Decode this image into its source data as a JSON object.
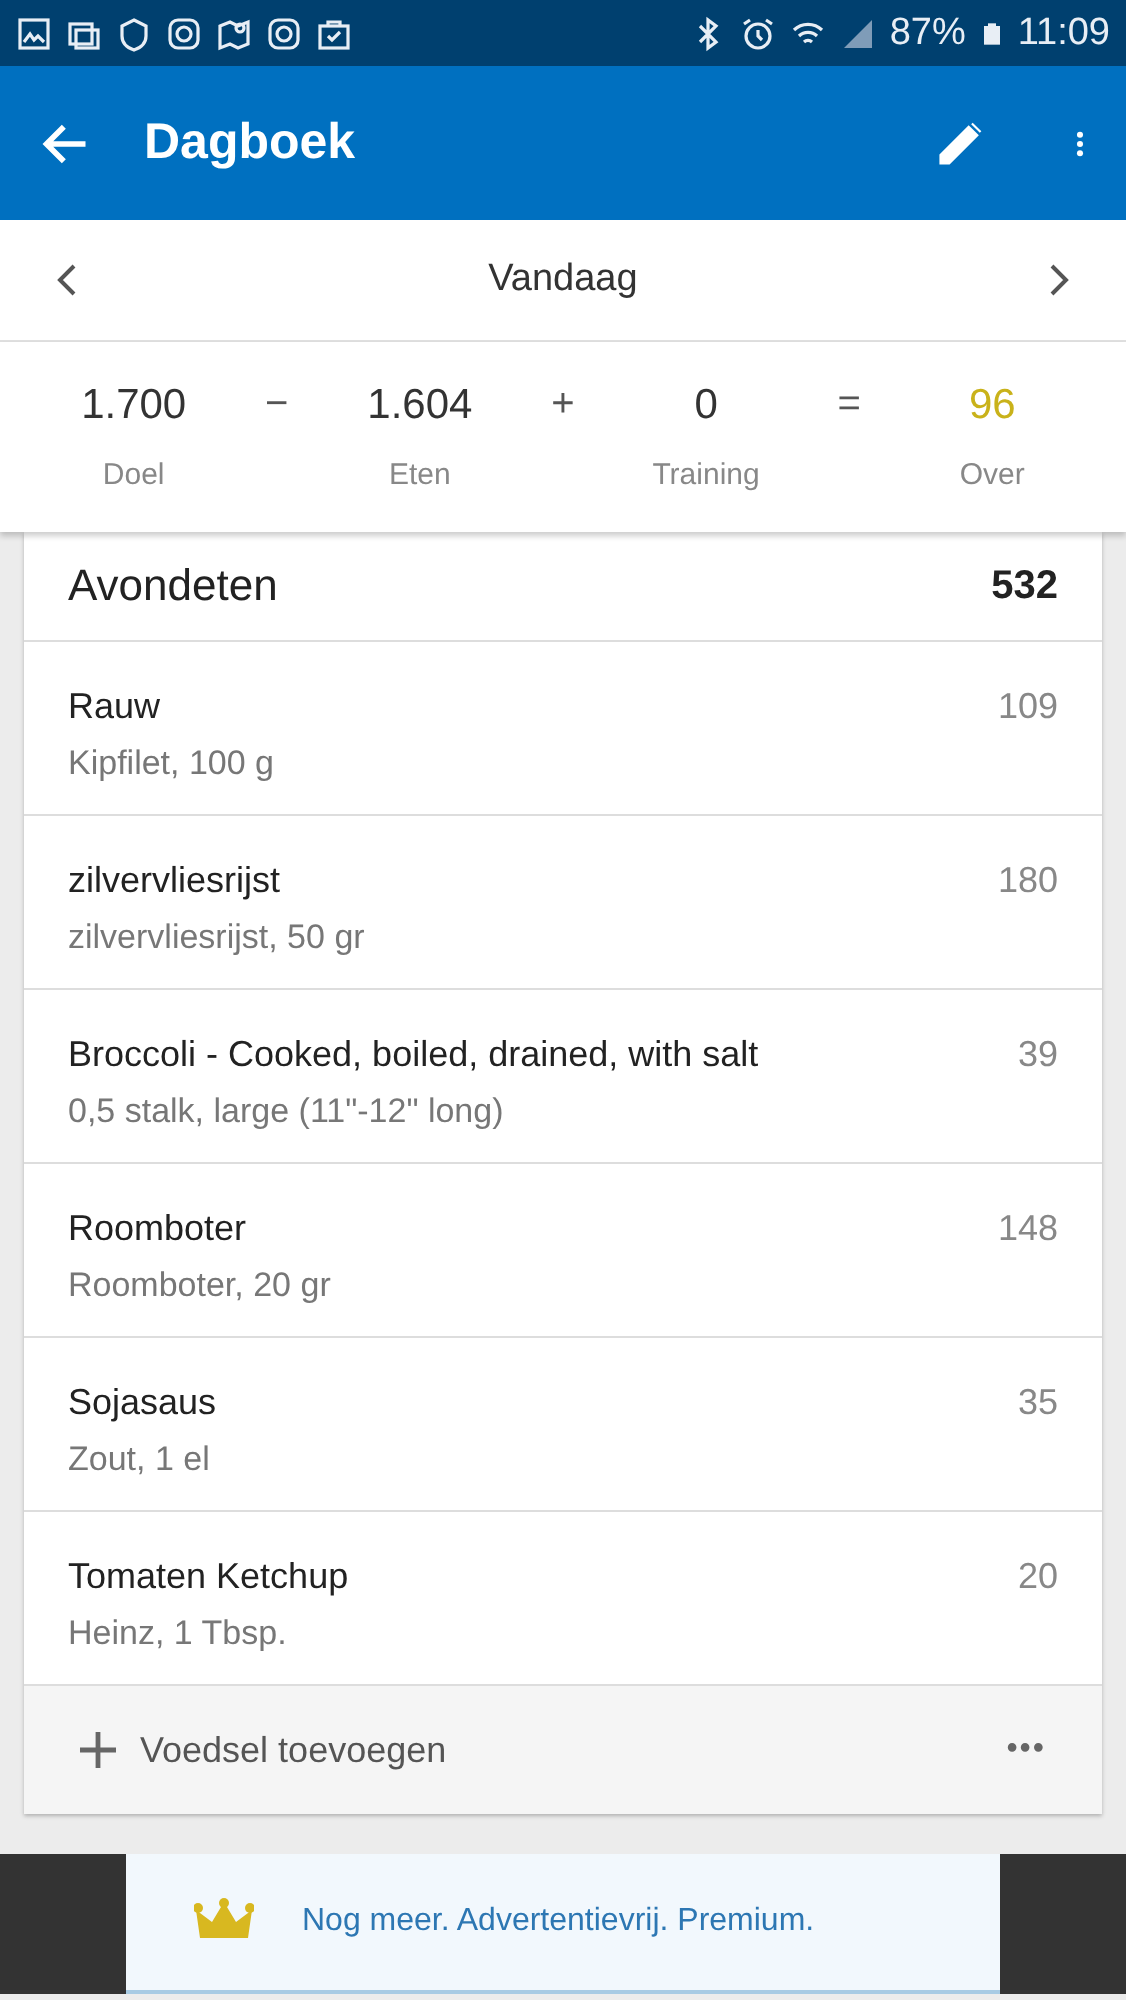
{
  "status_bar": {
    "battery": "87%",
    "time": "11:09"
  },
  "app_bar": {
    "title": "Dagboek"
  },
  "date_nav": {
    "label": "Vandaag"
  },
  "summary": [
    {
      "kind": "value",
      "value": "1.700",
      "label": "Doel"
    },
    {
      "kind": "operator",
      "symbol": "−"
    },
    {
      "kind": "value",
      "value": "1.604",
      "label": "Eten"
    },
    {
      "kind": "operator",
      "symbol": "+"
    },
    {
      "kind": "value",
      "value": "0",
      "label": "Training"
    },
    {
      "kind": "operator",
      "symbol": "="
    },
    {
      "kind": "remaining",
      "value": "96",
      "label": "Over"
    }
  ],
  "meal": {
    "title": "Avondeten",
    "total": "532",
    "items": [
      {
        "name": "Rauw",
        "detail": "Kipfilet, 100 g",
        "calories": "109"
      },
      {
        "name": "zilvervliesrijst",
        "detail": "zilvervliesrijst, 50 gr",
        "calories": "180"
      },
      {
        "name": "Broccoli - Cooked, boiled, drained, with salt",
        "detail": "0,5 stalk, large (11\"-12\" long)",
        "calories": "39"
      },
      {
        "name": "Roomboter",
        "detail": "Roomboter, 20 gr",
        "calories": "148"
      },
      {
        "name": "Sojasaus",
        "detail": "Zout, 1 el",
        "calories": "35"
      },
      {
        "name": "Tomaten Ketchup",
        "detail": "Heinz, 1 Tbsp.",
        "calories": "20"
      }
    ],
    "add_label": "Voedsel toevoegen",
    "more": "•••"
  },
  "ad_banner": {
    "text": "Nog meer. Advertentievrij. Premium."
  }
}
